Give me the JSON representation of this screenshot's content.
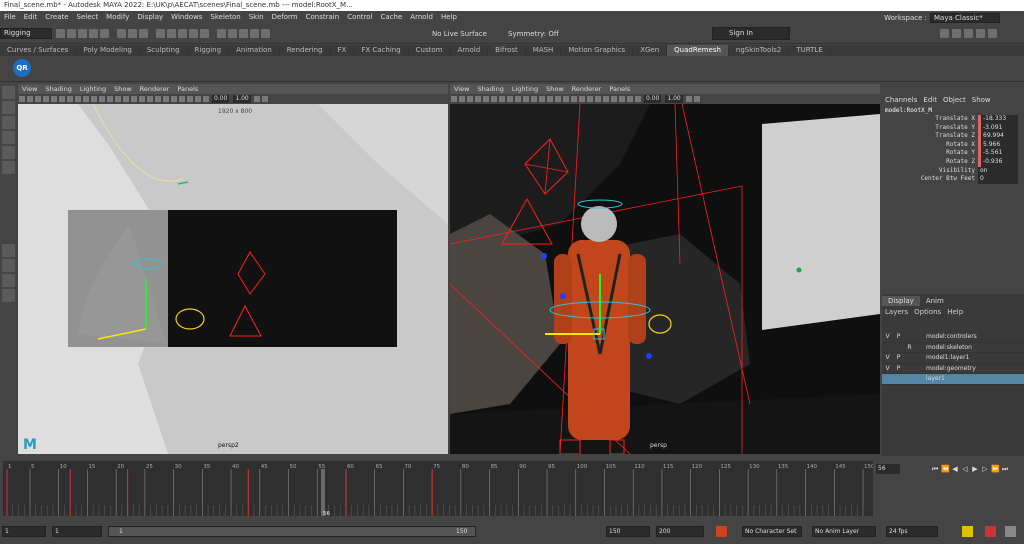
{
  "window": {
    "title": "Final_scene.mb* - Autodesk MAYA 2022: E:\\UK\\p\\AECAT\\scenes\\Final_scene.mb   ---   model:RootX_M..."
  },
  "menubar": {
    "items": [
      "File",
      "Edit",
      "Create",
      "Select",
      "Modify",
      "Display",
      "Windows",
      "Skeleton",
      "Skin",
      "Deform",
      "Constrain",
      "Control",
      "Cache",
      "Arnold",
      "Help"
    ]
  },
  "workspace": {
    "label": "Workspace :",
    "value": "Maya Classic*"
  },
  "statusline": {
    "menuset": "Rigging",
    "live_surface": "No Live Surface",
    "symmetry": "Symmetry: Off",
    "sign_in": "Sign In"
  },
  "shelf": {
    "tabs": [
      "Curves / Surfaces",
      "Poly Modeling",
      "Sculpting",
      "Rigging",
      "Animation",
      "Rendering",
      "FX",
      "FX Caching",
      "Custom",
      "Arnold",
      "Bifrost",
      "MASH",
      "Motion Graphics",
      "XGen",
      "QuadRemesh",
      "ngSkinTools2",
      "TURTLE"
    ],
    "active_tab": "QuadRemesh",
    "qr_label": "QR"
  },
  "viewport_menu": [
    "View",
    "Shading",
    "Lighting",
    "Show",
    "Renderer",
    "Panels"
  ],
  "viewport1": {
    "resolution": "1920 x 800",
    "camera": "persp2",
    "field1": "0.00",
    "field2": "1.00"
  },
  "viewport2": {
    "camera": "persp",
    "field1": "0.00",
    "field2": "1.00"
  },
  "channelbox": {
    "menu": [
      "Channels",
      "Edit",
      "Object",
      "Show"
    ],
    "object": "model:RootX_M",
    "attributes": [
      {
        "name": "Translate X",
        "value": "-18.333",
        "keyed": true
      },
      {
        "name": "Translate Y",
        "value": "-3.091",
        "keyed": true
      },
      {
        "name": "Translate Z",
        "value": "69.994",
        "keyed": true
      },
      {
        "name": "Rotate X",
        "value": "5.966",
        "keyed": true
      },
      {
        "name": "Rotate Y",
        "value": "-5.561",
        "keyed": true
      },
      {
        "name": "Rotate Z",
        "value": "-0.936",
        "keyed": true
      },
      {
        "name": "Visibility",
        "value": "on",
        "keyed": false
      },
      {
        "name": "Center Btw Feet",
        "value": "0",
        "keyed": false
      }
    ]
  },
  "layers": {
    "tabs": [
      "Display",
      "Anim"
    ],
    "active_tab": "Display",
    "menu": [
      "Layers",
      "Options",
      "Help"
    ],
    "rows": [
      {
        "v": "V",
        "p": "P",
        "r": "",
        "name": "model:controlers",
        "selected": false
      },
      {
        "v": "",
        "p": "",
        "r": "R",
        "name": "model:skeleton",
        "selected": false
      },
      {
        "v": "V",
        "p": "P",
        "r": "",
        "name": "model1:layer1",
        "selected": false
      },
      {
        "v": "V",
        "p": "P",
        "r": "",
        "name": "model:geometry",
        "selected": false
      },
      {
        "v": "",
        "p": "",
        "r": "",
        "name": "layer1",
        "selected": true
      }
    ]
  },
  "timeslider": {
    "start": 1,
    "end": 150,
    "current": 56,
    "tick_labels": [
      1,
      5,
      10,
      15,
      20,
      25,
      30,
      35,
      40,
      45,
      50,
      55,
      60,
      65,
      70,
      75,
      80,
      85,
      90,
      95,
      100,
      105,
      110,
      115,
      120,
      125,
      130,
      135,
      140,
      145,
      150
    ],
    "keys": [
      1,
      12,
      22,
      43,
      60,
      75
    ],
    "current_frame_field": "56"
  },
  "rangeslider": {
    "start": "1",
    "playback_start": "1",
    "range_start_label": "1",
    "range_end_label": "150",
    "playback_end": "150",
    "end": "200",
    "character_set": "No Character Set",
    "anim_layer": "No Anim Layer",
    "fps": "24 fps"
  },
  "colors": {
    "accent": "#5285a6",
    "key_red": "#d33",
    "viewport_bg_dark": "#0f0f0f",
    "viewport_bg_light": "#c9c9c9",
    "rig_red": "#ff1e1e",
    "suit_orange": "#c2461c"
  }
}
